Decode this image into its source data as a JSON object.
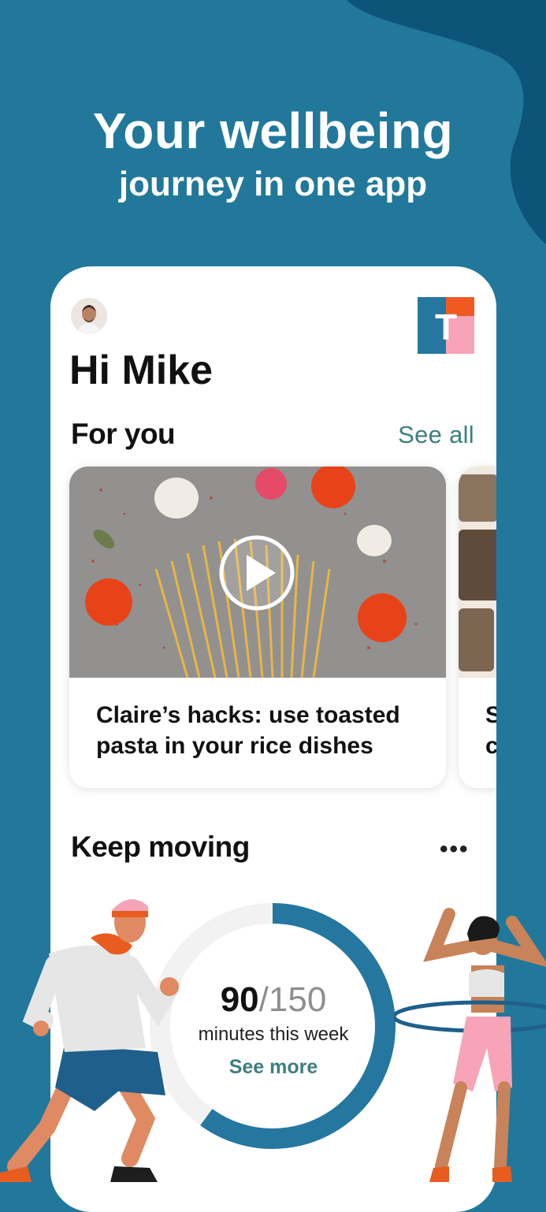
{
  "headline": {
    "line1": "Your wellbeing",
    "line2": "journey in one app"
  },
  "app": {
    "greeting": "Hi Mike",
    "logo_letter": "T"
  },
  "for_you": {
    "title": "For you",
    "see_all": "See all",
    "cards": [
      {
        "title": "Claire’s hacks: use toasted pasta in your rice dishes"
      },
      {
        "title": "S\nc"
      }
    ]
  },
  "keep_moving": {
    "title": "Keep moving",
    "more_label": "•••",
    "progress": {
      "current": "90",
      "separator": "/",
      "goal": "150",
      "current_value": 90,
      "goal_value": 150,
      "label": "minutes this week",
      "see_more": "See more"
    }
  },
  "colors": {
    "background": "#21789b",
    "blob": "#0c5478",
    "accent_teal": "#3d7e80",
    "ring_blue": "#2577a0",
    "ring_track": "#f2f2f2",
    "logo_orange": "#f05a22",
    "logo_pink": "#f7a3b8"
  }
}
